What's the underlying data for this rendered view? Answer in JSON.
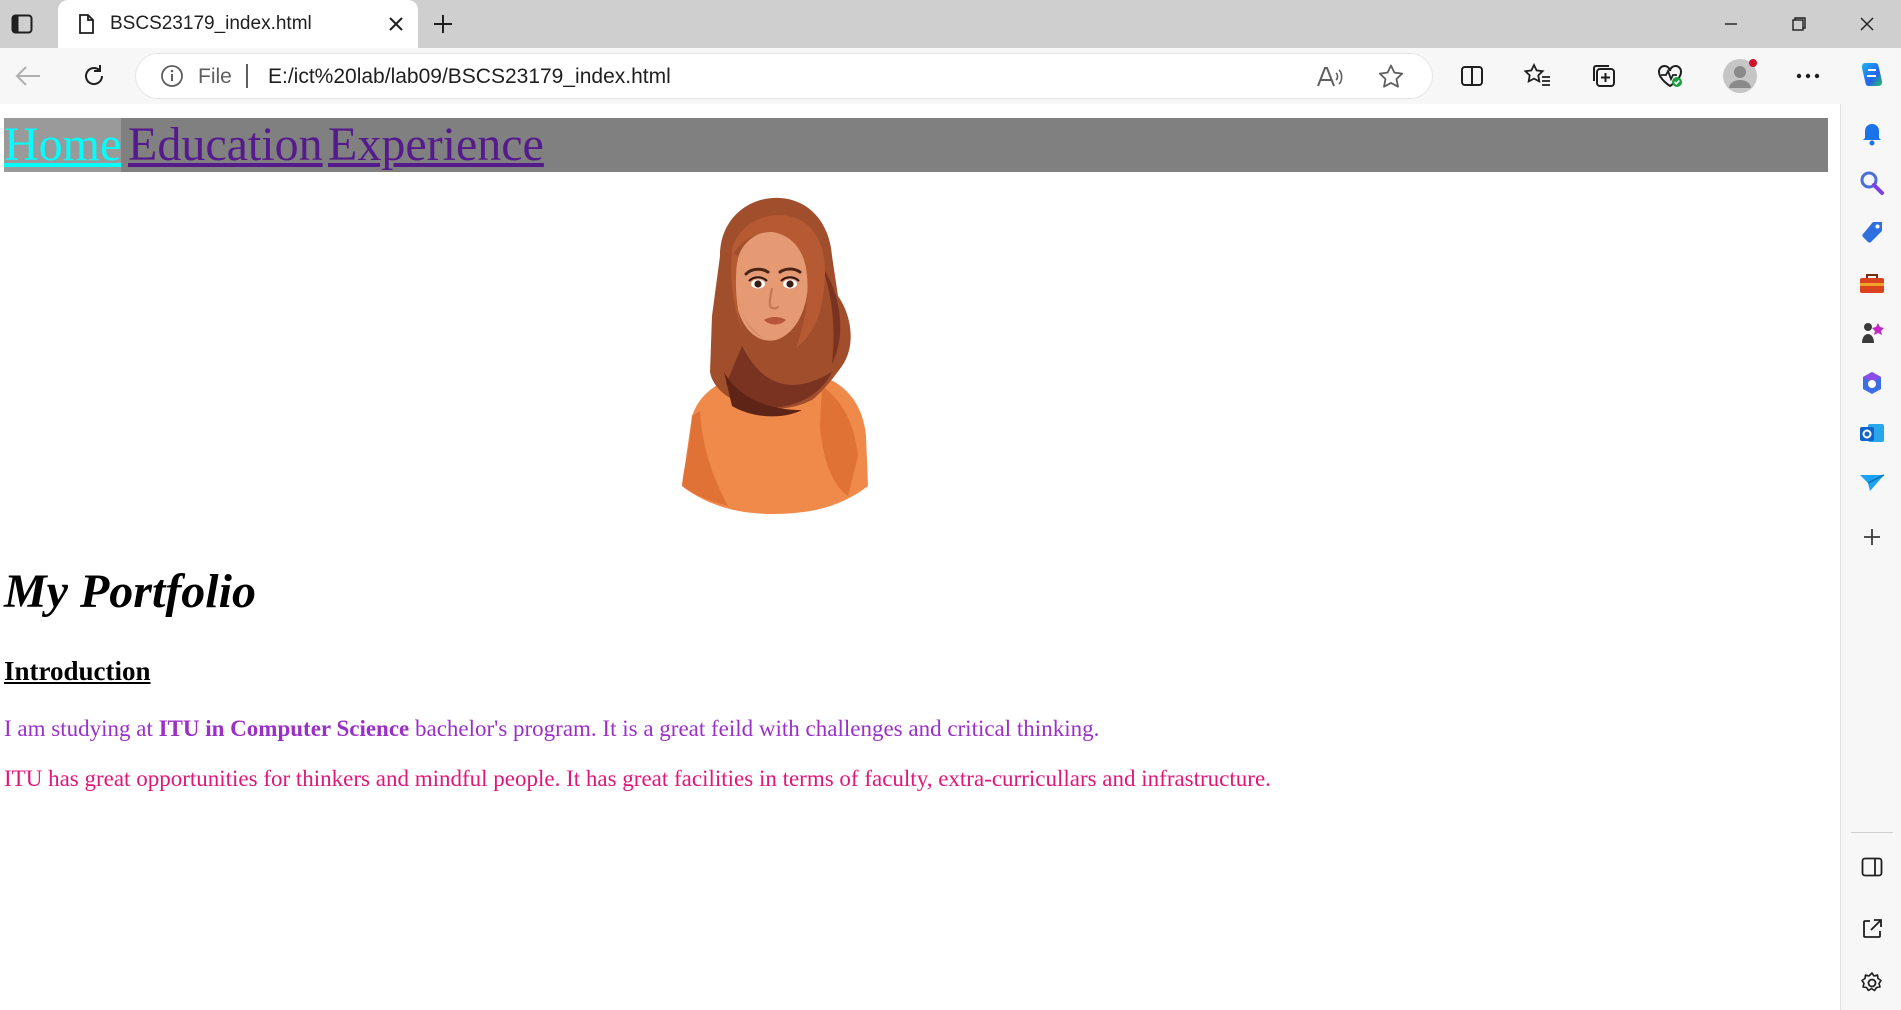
{
  "browser": {
    "tab": {
      "title": "BSCS23179_index.html"
    },
    "omnibox": {
      "scheme_label": "File",
      "url": "E:/ict%20lab/lab09/BSCS23179_index.html"
    },
    "icons": {
      "tab_actions": "tab-actions-icon",
      "favicon": "page-icon",
      "close": "close-icon",
      "new_tab": "plus-icon",
      "back": "back-arrow-icon",
      "refresh": "refresh-icon",
      "info": "info-icon",
      "read_aloud": "read-aloud-icon",
      "favorite": "star-icon",
      "split_screen": "split-screen-icon",
      "favorites": "favorites-icon",
      "collections": "collections-icon",
      "performance": "heart-pulse-icon",
      "profile": "avatar-icon",
      "more": "more-icon",
      "copilot": "copilot-icon"
    },
    "sidebar": [
      "bell-icon",
      "search-icon",
      "shopping-tag-icon",
      "toolbox-icon",
      "games-icon",
      "office-icon",
      "outlook-icon",
      "send-icon",
      "add-icon",
      "sidebar-panel-icon",
      "external-link-icon",
      "settings-gear-icon"
    ]
  },
  "page": {
    "nav": {
      "home": "Home",
      "education": "Education",
      "experience": "Experience"
    },
    "avatar_alt": "woman in hijab illustration",
    "title": "My Portfolio",
    "section_heading": "Introduction",
    "para1": {
      "before": "I am studying at ",
      "bold": "ITU in Computer Science",
      "after": " bachelor's program. It is a great feild with challenges and critical thinking."
    },
    "para2": "ITU has great opportunities for thinkers and mindful people. It has great facilities in terms of faculty, extra-curricullars and infrastructure."
  },
  "colors": {
    "nav_bg": "#808080",
    "nav_home": "#00ffff",
    "nav_visited": "#551a8b",
    "para1": "#9b30c9",
    "para2": "#e0167a"
  }
}
